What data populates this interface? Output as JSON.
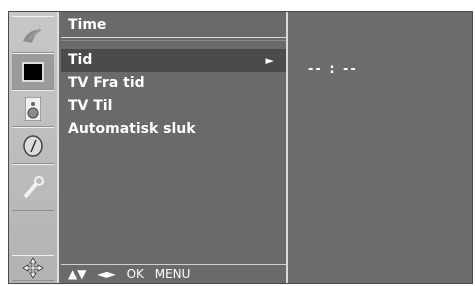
{
  "menu": {
    "title": "Time",
    "items": [
      {
        "label": "Tid",
        "selected": true
      },
      {
        "label": "TV Fra tid",
        "selected": false
      },
      {
        "label": "TV Til",
        "selected": false
      },
      {
        "label": "Automatisk sluk",
        "selected": false
      }
    ],
    "selected_arrow": "►"
  },
  "nav": {
    "up_down": "▲▼",
    "left_right": "◄►",
    "ok": "OK",
    "menu": "MENU"
  },
  "detail": {
    "time_value": "-- : --"
  },
  "sidebar_icons": [
    "satellite-dish-icon",
    "screen-icon",
    "speaker-icon",
    "clock-icon",
    "wrench-icon",
    "move-cross-icon"
  ],
  "colors": {
    "menu_bg": "#6a6a6a",
    "selected_bg": "#4b4b4b",
    "icon_bar_bg": "#bdbdbd",
    "text": "#ffffff"
  }
}
